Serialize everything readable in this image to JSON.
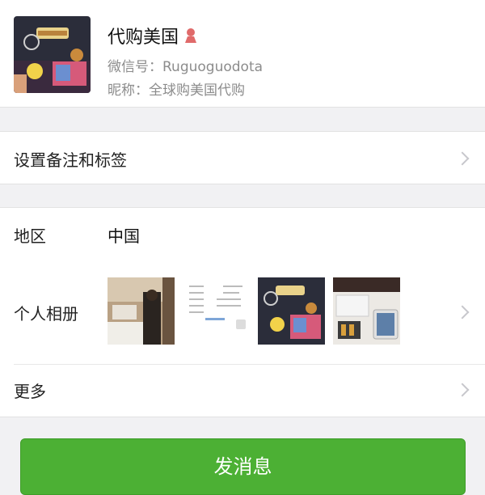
{
  "profile": {
    "name": "代购美国",
    "wechat_id_label": "微信号：",
    "wechat_id": "Ruguoguodota",
    "nickname_label": "昵称：",
    "nickname": "全球购美国代购",
    "gender_icon": "female-icon",
    "gender_color": "#e06a6a"
  },
  "rows": {
    "remark_label": "设置备注和标签",
    "region_label": "地区",
    "region_value": "中国",
    "album_label": "个人相册",
    "more_label": "更多"
  },
  "album": {
    "thumbnails": [
      "bathroom-photo",
      "screenshot-photo",
      "products-photo",
      "electronics-photo"
    ]
  },
  "actions": {
    "send_message": "发消息"
  },
  "colors": {
    "accent_green": "#4cb034",
    "background": "#f1f1f3"
  }
}
